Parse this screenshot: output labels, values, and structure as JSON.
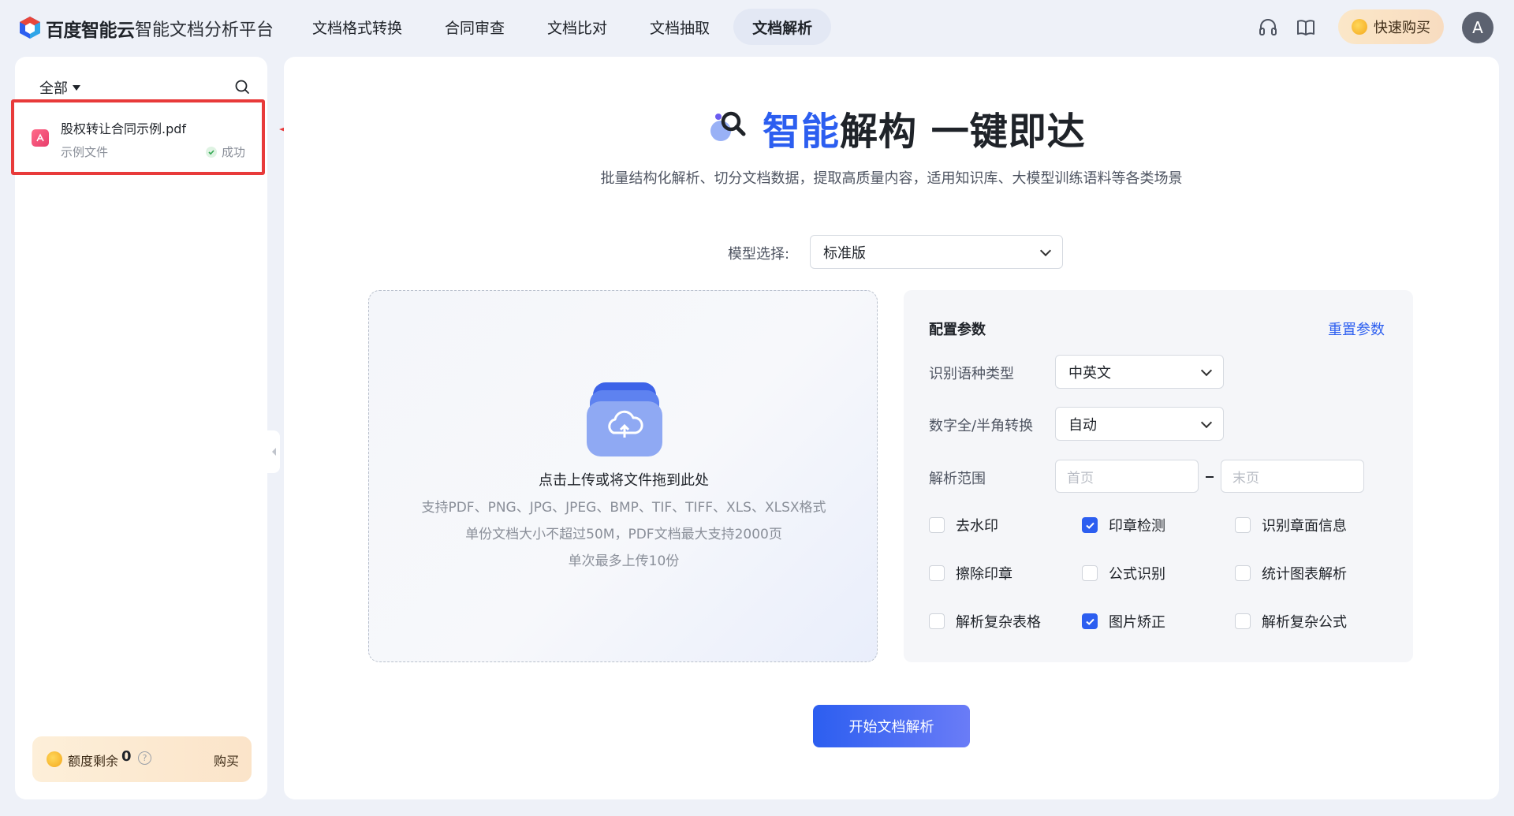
{
  "header": {
    "logo_text": "百度智能云",
    "platform": "智能文档分析平台",
    "nav": [
      {
        "label": "文档格式转换",
        "active": false
      },
      {
        "label": "合同审查",
        "active": false
      },
      {
        "label": "文档比对",
        "active": false
      },
      {
        "label": "文档抽取",
        "active": false
      },
      {
        "label": "文档解析",
        "active": true
      }
    ],
    "buy_label": "快速购买",
    "avatar_letter": "A",
    "icons": [
      "headset-icon",
      "book-icon"
    ]
  },
  "sidebar": {
    "filter_label": "全部",
    "file": {
      "name": "股权转让合同示例.pdf",
      "tag": "示例文件",
      "status": "成功"
    },
    "quota": {
      "label": "额度剩余",
      "value": "0",
      "help": "?",
      "buy": "购买"
    }
  },
  "main": {
    "title_blue": "智能",
    "title_rest": "解构 一键即达",
    "subtitle": "批量结构化解析、切分文档数据，提取高质量内容，适用知识库、大模型训练语料等各类场景",
    "model_label": "模型选择:",
    "model_value": "标准版",
    "upload": {
      "main": "点击上传或将文件拖到此处",
      "line1": "支持PDF、PNG、JPG、JPEG、BMP、TIF、TIFF、XLS、XLSX格式",
      "line2": "单份文档大小不超过50M，PDF文档最大支持2000页",
      "line3": "单次最多上传10份"
    },
    "config": {
      "title": "配置参数",
      "reset": "重置参数",
      "lang_label": "识别语种类型",
      "lang_value": "中英文",
      "width_label": "数字全/半角转换",
      "width_value": "自动",
      "range_label": "解析范围",
      "range_start_placeholder": "首页",
      "range_end_placeholder": "末页",
      "options": [
        {
          "label": "去水印",
          "checked": false
        },
        {
          "label": "印章检测",
          "checked": true
        },
        {
          "label": "识别章面信息",
          "checked": false
        },
        {
          "label": "擦除印章",
          "checked": false
        },
        {
          "label": "公式识别",
          "checked": false
        },
        {
          "label": "统计图表解析",
          "checked": false
        },
        {
          "label": "解析复杂表格",
          "checked": false
        },
        {
          "label": "图片矫正",
          "checked": true
        },
        {
          "label": "解析复杂公式",
          "checked": false
        }
      ]
    },
    "start_button": "开始文档解析"
  },
  "colors": {
    "accent": "#2c5ef0",
    "highlight_border": "#e83a3a",
    "background": "#eef1f8"
  }
}
